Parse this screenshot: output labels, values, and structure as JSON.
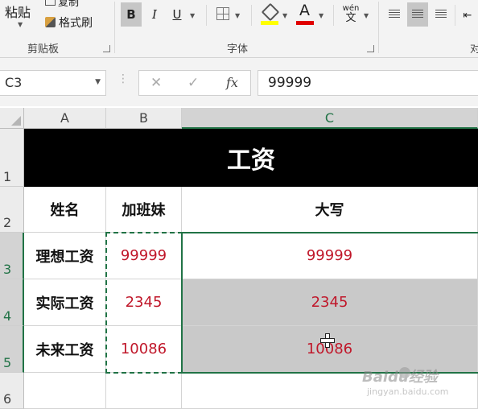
{
  "ribbon": {
    "paste_label": "粘贴",
    "copy_label": "复制",
    "format_painter_label": "格式刷",
    "clipboard_group": "剪贴板",
    "font_group": "字体",
    "partial_group": "对",
    "bold": "B",
    "italic": "I",
    "underline": "U",
    "font_color_glyph": "A",
    "phonetic_top": "wén",
    "phonetic_bottom": "文",
    "highlight_color": "#ffff00",
    "font_color": "#e00000"
  },
  "formula_bar": {
    "name_box": "C3",
    "cancel_glyph": "✕",
    "enter_glyph": "✓",
    "fx": "fx",
    "formula": "99999"
  },
  "sheet": {
    "columns": [
      "A",
      "B",
      "C"
    ],
    "rows": [
      "1",
      "2",
      "3",
      "4",
      "5",
      "6"
    ],
    "title": "工资",
    "header": {
      "a": "姓名",
      "b": "加班妹",
      "c": "大写"
    },
    "data": [
      {
        "a": "理想工资",
        "b": "99999",
        "c": "99999"
      },
      {
        "a": "实际工资",
        "b": "2345",
        "c": "2345"
      },
      {
        "a": "未来工资",
        "b": "10086",
        "c": "10086"
      }
    ]
  },
  "watermark": {
    "brand": "Baidu经验",
    "url": "jingyan.baidu.com"
  }
}
